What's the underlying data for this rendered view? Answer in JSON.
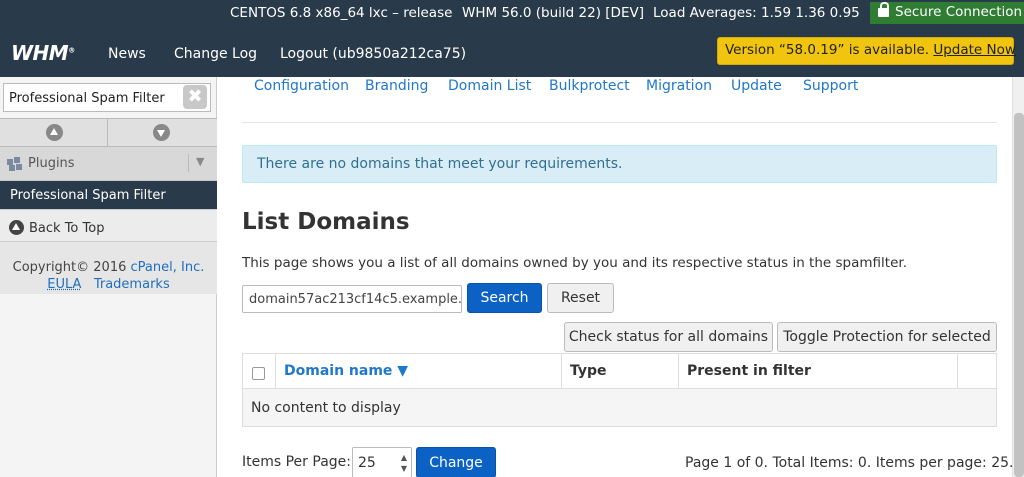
{
  "topbar": {
    "os": "CENTOS 6.8 x86_64 lxc – release",
    "version": "WHM 56.0 (build 22) [DEV]",
    "load": "Load Averages: 1.59 1.36 0.95",
    "secure": "Secure Connection"
  },
  "nav": {
    "logo": "WHM",
    "logo_tm": "®",
    "news": "News",
    "changelog": "Change Log",
    "logout": "Logout (ub9850a212ca75)",
    "update_text": "Version “58.0.19” is available.",
    "update_link": "Update Now"
  },
  "sidebar": {
    "filter_value": "Professional Spam Filter",
    "clear": "✖",
    "plugins": "Plugins",
    "active_item": "Professional Spam Filter",
    "back_to_top": "Back To Top",
    "copyright": "Copyright© 2016",
    "company": "cPanel, Inc.",
    "eula": "EULA",
    "trademarks": "Trademarks"
  },
  "tabs": [
    "Configuration",
    "Branding",
    "Domain List",
    "Bulkprotect",
    "Migration",
    "Update",
    "Support"
  ],
  "alert": "There are no domains that meet your requirements.",
  "page": {
    "title": "List Domains",
    "description": "This page shows you a list of all domains owned by you and its respective status in the spamfilter.",
    "search_value": "domain57ac213cf14c5.example.",
    "search_button": "Search",
    "reset_button": "Reset",
    "check_all_button": "Check status for all domains",
    "toggle_button": "Toggle Protection for selected"
  },
  "table": {
    "headers": [
      "Domain name ▼",
      "Type",
      "Present in filter"
    ],
    "empty": "No content to display"
  },
  "pagination": {
    "items_per_page_label": "Items Per Page:",
    "items_per_page": "25",
    "change_button": "Change",
    "info": "Page 1 of 0. Total Items: 0. Items per page: 25."
  },
  "colors": {
    "header_bg": "#293a4a",
    "link": "#1f78c8",
    "primary": "#0b62c4",
    "update_banner": "#f1c40f",
    "secure": "#2f7d32"
  }
}
